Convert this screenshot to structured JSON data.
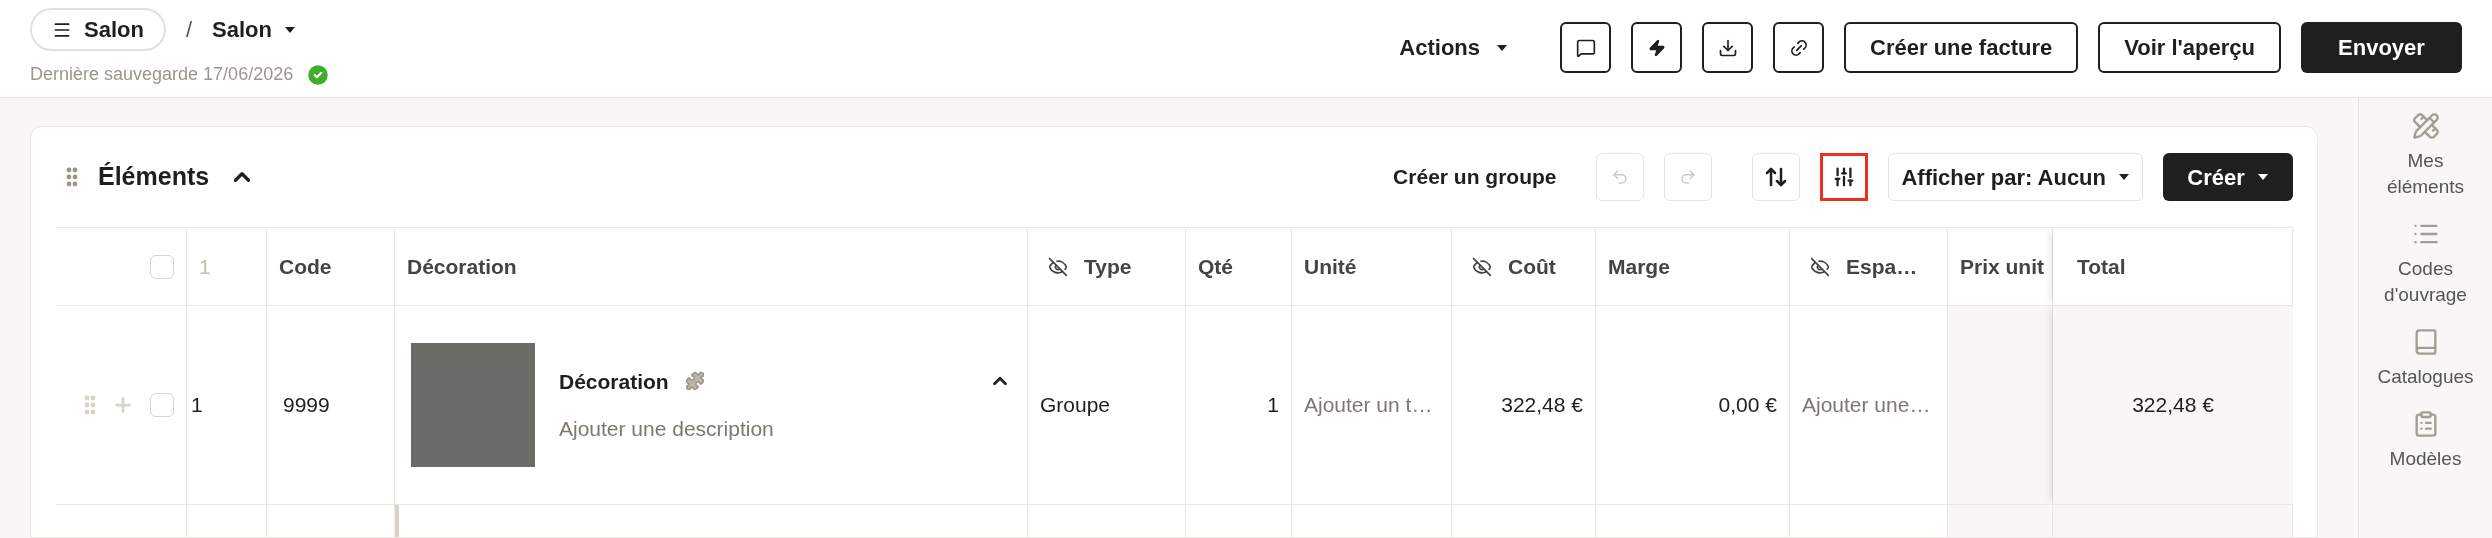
{
  "header": {
    "menu_label": "Salon",
    "separator": "/",
    "current": "Salon",
    "last_saved": "Dernière sauvegarde 17/06/2026",
    "saved": true,
    "actions_label": "Actions",
    "buttons": [
      {
        "label": "Créer une facture",
        "kind": "outline"
      },
      {
        "label": "Voir l'aperçu",
        "kind": "outline"
      },
      {
        "label": "Envoyer",
        "kind": "primary"
      }
    ]
  },
  "section": {
    "title": "Éléments",
    "expanded": true,
    "create_group": "Créer un groupe",
    "undo_disabled": true,
    "redo_disabled": true,
    "columns_settings_selected": true,
    "group_by": "Afficher par: Aucun",
    "create": "Créer"
  },
  "table": {
    "header_checked": false,
    "columns": [
      {
        "label": "1",
        "kind": "index",
        "hidden": false
      },
      {
        "label": "Code",
        "kind": "text",
        "hidden": false
      },
      {
        "label": "Décoration",
        "kind": "text",
        "hidden": false
      },
      {
        "label": "Type",
        "kind": "text",
        "hidden": true
      },
      {
        "label": "Qté",
        "kind": "text",
        "hidden": false
      },
      {
        "label": "Unité",
        "kind": "text",
        "hidden": false
      },
      {
        "label": "Coût",
        "kind": "text",
        "hidden": true
      },
      {
        "label": "Marge",
        "kind": "text",
        "hidden": false
      },
      {
        "label": "Espa…",
        "kind": "text",
        "hidden": true
      },
      {
        "label": "Prix unit",
        "kind": "text",
        "hidden": false
      },
      {
        "label": "Total",
        "kind": "text",
        "hidden": false
      }
    ],
    "rows": [
      {
        "checked": false,
        "index": "1",
        "code": "9999",
        "name": "Décoration",
        "description_placeholder": "Ajouter une description",
        "expanded": true,
        "type": "Groupe",
        "qty": "1",
        "unit_placeholder": "Ajouter un t…",
        "cost": "322,48 €",
        "margin": "0,00 €",
        "space_placeholder": "Ajouter une…",
        "total": "322,48 €"
      }
    ]
  },
  "sidebar": {
    "items": [
      {
        "label": "Mes éléments",
        "kind": "tools"
      },
      {
        "label": "Codes d'ouvrage",
        "kind": "list"
      },
      {
        "label": "Catalogues",
        "kind": "book"
      },
      {
        "label": "Modèles",
        "kind": "clipboard"
      }
    ]
  }
}
